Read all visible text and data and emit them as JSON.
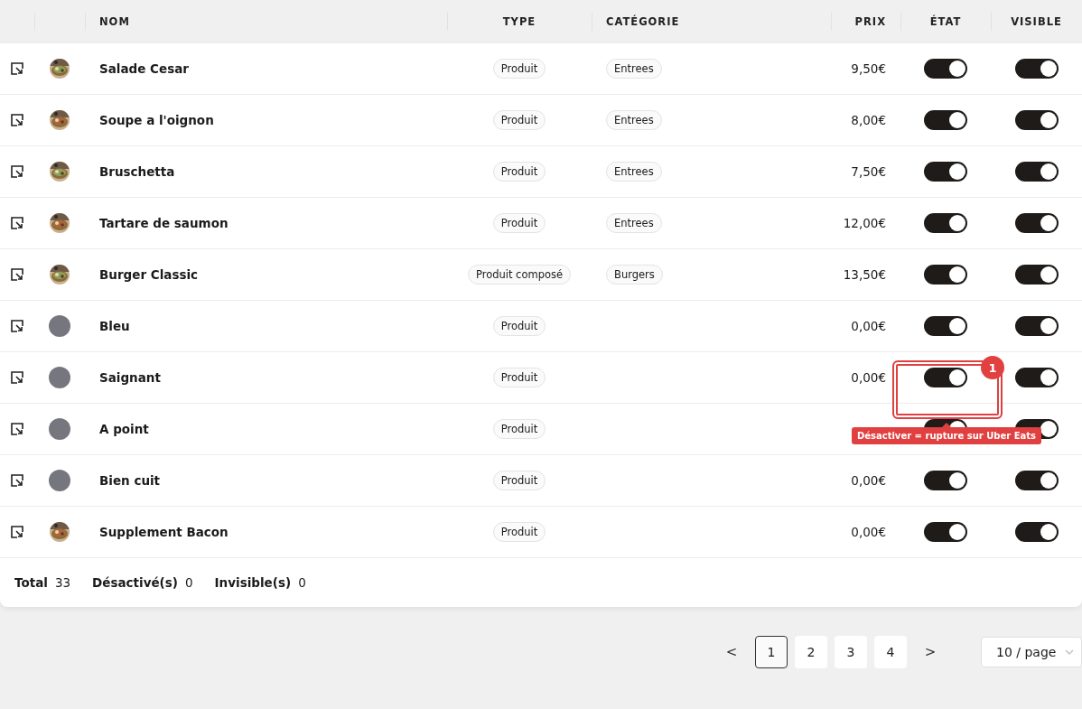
{
  "table": {
    "columns": [
      {
        "label": "NOM"
      },
      {
        "label": "TYPE"
      },
      {
        "label": "CATÉGORIE"
      },
      {
        "label": "PRIX"
      },
      {
        "label": "ÉTAT"
      },
      {
        "label": "VISIBLE"
      }
    ],
    "rows": [
      {
        "name": "Salade Cesar",
        "type": "Produit",
        "category": "Entrees",
        "price": "9,50€",
        "active": true,
        "visible": true
      },
      {
        "name": "Soupe a l'oignon",
        "type": "Produit",
        "category": "Entrees",
        "price": "8,00€",
        "active": true,
        "visible": true
      },
      {
        "name": "Bruschetta",
        "type": "Produit",
        "category": "Entrees",
        "price": "7,50€",
        "active": true,
        "visible": true
      },
      {
        "name": "Tartare de saumon",
        "type": "Produit",
        "category": "Entrees",
        "price": "12,00€",
        "active": true,
        "visible": true
      },
      {
        "name": "Burger Classic",
        "type": "Produit composé",
        "category": "Burgers",
        "price": "13,50€",
        "active": true,
        "visible": true
      },
      {
        "kind": "placeholder",
        "name": "Bleu",
        "type": "Produit",
        "price": "0,00€",
        "active": true,
        "visible": true
      },
      {
        "kind": "placeholder",
        "name": "Saignant",
        "type": "Produit",
        "price": "0,00€",
        "active": true,
        "visible": true,
        "annotation": {
          "badge": "1",
          "tooltip": "Désactiver = rupture sur Uber Eats"
        }
      },
      {
        "kind": "placeholder",
        "name": "A point",
        "type": "Produit",
        "active": true,
        "visible": true
      },
      {
        "kind": "placeholder",
        "name": "Bien cuit",
        "type": "Produit",
        "price": "0,00€",
        "active": true,
        "visible": true
      },
      {
        "name": "Supplement Bacon",
        "type": "Produit",
        "price": "0,00€",
        "active": true,
        "visible": true
      }
    ]
  },
  "summary": [
    {
      "label": "Total",
      "value": "33"
    },
    {
      "label": "Désactivé(s)",
      "value": "0"
    },
    {
      "label": "Invisible(s)",
      "value": "0"
    }
  ],
  "pagination": {
    "prev": "<",
    "next": ">",
    "pages": [
      {
        "label": "1",
        "selected": true
      },
      {
        "label": "2",
        "selected": false
      },
      {
        "label": "3",
        "selected": false
      },
      {
        "label": "4",
        "selected": false
      }
    ],
    "page_size": "10 / page"
  }
}
